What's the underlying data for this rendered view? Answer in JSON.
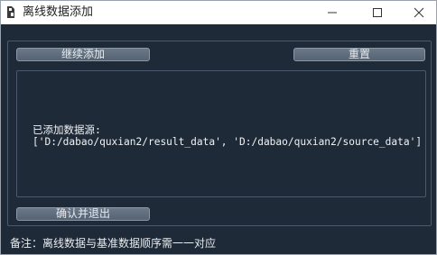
{
  "window": {
    "title": "离线数据添加",
    "minimize_icon": "minimize-icon",
    "maximize_icon": "maximize-icon",
    "close_icon": "close-icon"
  },
  "buttons": {
    "continue_add": "继续添加",
    "reset": "重置",
    "confirm_exit": "确认并退出"
  },
  "output": {
    "line1": "已添加数据源:",
    "line2": "['D:/dabao/quxian2/result_data', 'D:/dabao/quxian2/source_data']"
  },
  "note": "备注：离线数据与基准数据顺序需一一对应",
  "colors": {
    "background": "#1e2a38",
    "button": "#5f6d7c",
    "text": "#f0f2f5",
    "titlebar": "#ffffff"
  }
}
